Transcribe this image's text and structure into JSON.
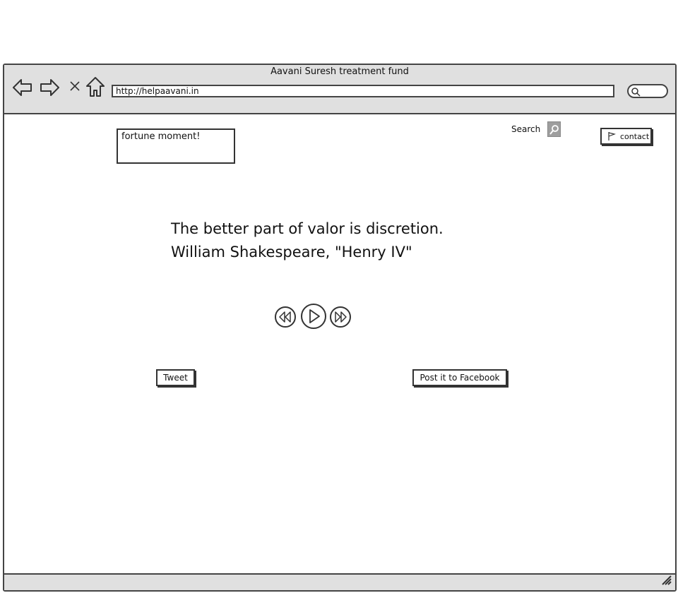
{
  "window": {
    "title": "Aavani Suresh treatment fund",
    "url": "http://helpaavani.in"
  },
  "nav": {
    "back_icon": "arrow-left-icon",
    "forward_icon": "arrow-right-icon",
    "stop_icon": "close-icon",
    "home_icon": "home-icon",
    "search_icon": "search-icon"
  },
  "fortune": {
    "label": "fortune moment!"
  },
  "header": {
    "search_label": "Search",
    "contact_label": "contact"
  },
  "quote": {
    "text": "The better part of valor is discretion.",
    "attribution": "William Shakespeare, \"Henry IV\""
  },
  "media": {
    "rewind_icon": "rewind-icon",
    "play_icon": "play-icon",
    "forward_icon": "fast-forward-icon"
  },
  "share": {
    "tweet_label": "Tweet",
    "facebook_label": "Post it to Facebook"
  }
}
